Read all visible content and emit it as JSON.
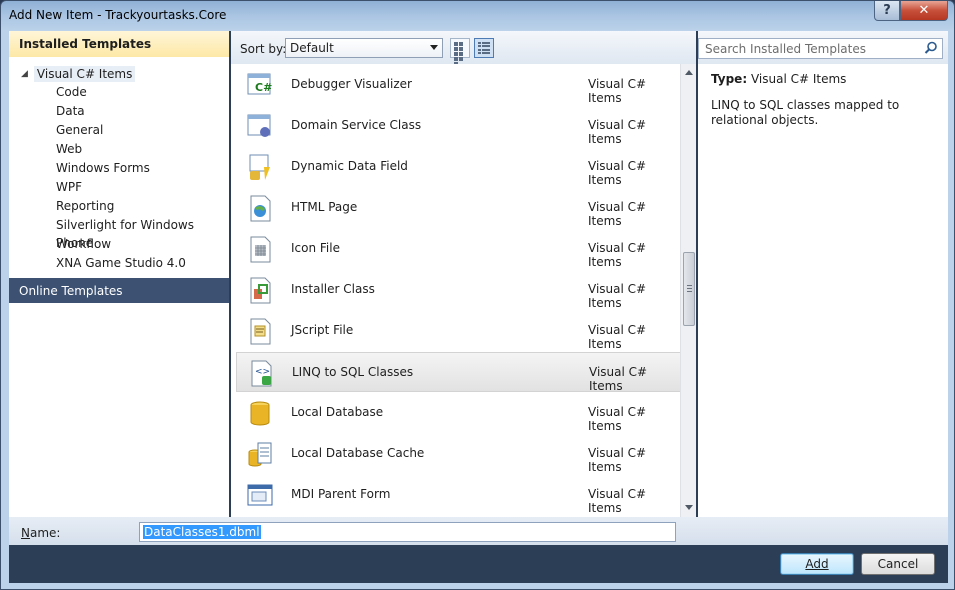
{
  "window": {
    "title": "Add New Item - Trackyourtasks.Core",
    "help_label": "?",
    "close_label": "✕"
  },
  "left": {
    "installed_header": "Installed Templates",
    "root": "Visual C# Items",
    "children": [
      "Code",
      "Data",
      "General",
      "Web",
      "Windows Forms",
      "WPF",
      "Reporting",
      "Silverlight for Windows Phone",
      "Workflow",
      "XNA Game Studio 4.0"
    ],
    "online_header": "Online Templates"
  },
  "toolbar": {
    "sort_label": "Sort by:",
    "sort_value": "Default"
  },
  "search": {
    "placeholder": "Search Installed Templates"
  },
  "items": [
    {
      "name": "Debugger Visualizer",
      "category": "Visual C# Items",
      "icon": "debugger-visualizer-icon"
    },
    {
      "name": "Domain Service Class",
      "category": "Visual C# Items",
      "icon": "domain-service-icon"
    },
    {
      "name": "Dynamic Data Field",
      "category": "Visual C# Items",
      "icon": "dynamic-data-icon"
    },
    {
      "name": "HTML Page",
      "category": "Visual C# Items",
      "icon": "html-page-icon"
    },
    {
      "name": "Icon File",
      "category": "Visual C# Items",
      "icon": "icon-file-icon"
    },
    {
      "name": "Installer Class",
      "category": "Visual C# Items",
      "icon": "installer-class-icon"
    },
    {
      "name": "JScript File",
      "category": "Visual C# Items",
      "icon": "jscript-file-icon"
    },
    {
      "name": "LINQ to SQL Classes",
      "category": "Visual C# Items",
      "icon": "linq-to-sql-icon",
      "selected": true
    },
    {
      "name": "Local Database",
      "category": "Visual C# Items",
      "icon": "local-database-icon"
    },
    {
      "name": "Local Database Cache",
      "category": "Visual C# Items",
      "icon": "local-database-cache-icon"
    },
    {
      "name": "MDI Parent Form",
      "category": "Visual C# Items",
      "icon": "mdi-parent-form-icon"
    }
  ],
  "details": {
    "type_label": "Type:",
    "type_value": "Visual C# Items",
    "description": "LINQ to SQL classes mapped to relational objects."
  },
  "name_field": {
    "label": "Name:",
    "value": "DataClasses1.dbml"
  },
  "buttons": {
    "add": "Add",
    "cancel": "Cancel"
  },
  "colors": {
    "selection": "#3399ff",
    "online_header": "#3d5272",
    "installed_header": "#fde8a6"
  }
}
